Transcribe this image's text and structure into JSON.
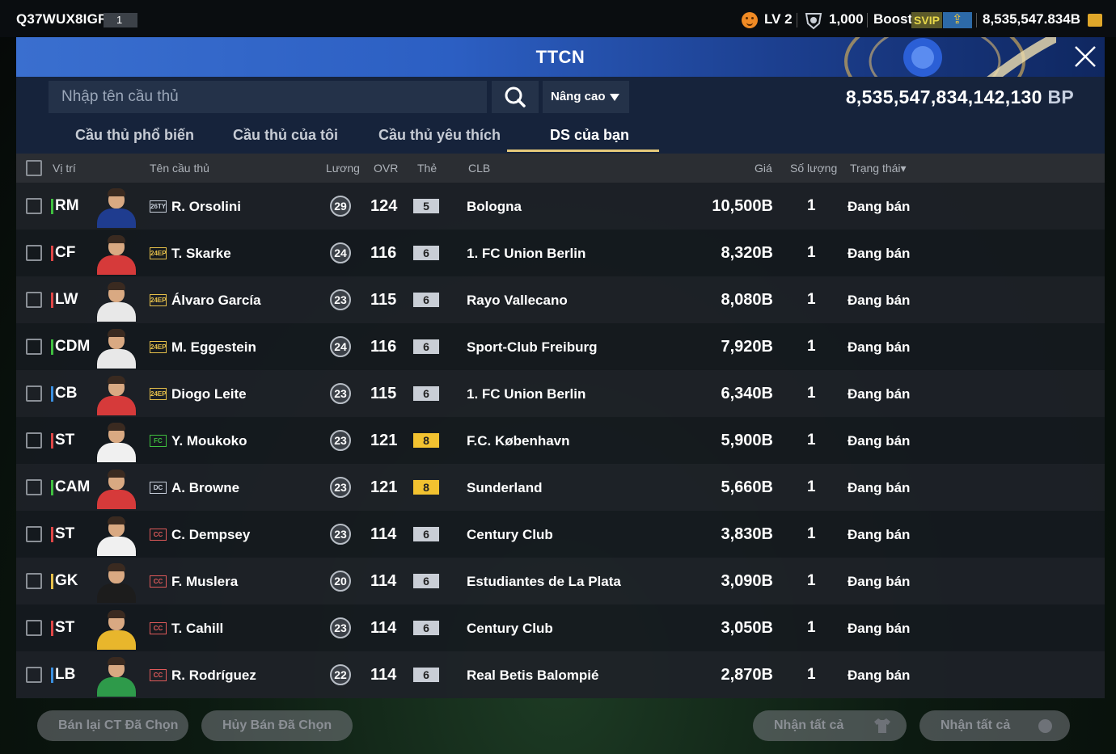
{
  "topbar": {
    "user_id": "Q37WUX8IGR",
    "user_badge": "1",
    "level": "LV 2",
    "points": "1,000",
    "boost_label": "Boost",
    "svip_label": "SVIP",
    "coins": "8,535,547.834B"
  },
  "header": {
    "title": "TTCN"
  },
  "search": {
    "placeholder": "Nhập tên cầu thủ",
    "advanced_label": "Nâng cao",
    "bp_amount": "8,535,547,834,142,130",
    "bp_unit": "BP"
  },
  "tabs": [
    {
      "label": "Cầu thủ phổ biến"
    },
    {
      "label": "Cầu thủ của tôi"
    },
    {
      "label": "Cầu thủ yêu thích"
    },
    {
      "label": "DS của bạn",
      "active": true
    }
  ],
  "columns": {
    "position": "Vị trí",
    "name": "Tên cầu thủ",
    "wage": "Lương",
    "ovr": "OVR",
    "card": "Thẻ",
    "club": "CLB",
    "price": "Giá",
    "qty": "Số lượng",
    "status": "Trạng thái▾"
  },
  "players": [
    {
      "pos": "RM",
      "pos_color": "#3fbf3f",
      "season": "26TY",
      "season_color": "#c9d0dc",
      "name": "R. Orsolini",
      "wage": "29",
      "ovr": "124",
      "card": "5",
      "card_gold": false,
      "club": "Bologna",
      "price": "10,500B",
      "qty": "1",
      "status": "Đang bán",
      "shirt": "#1f3c8f"
    },
    {
      "pos": "CF",
      "pos_color": "#e04646",
      "season": "24EP",
      "season_color": "#e6c04a",
      "name": "T. Skarke",
      "wage": "24",
      "ovr": "116",
      "card": "6",
      "card_gold": false,
      "club": "1. FC Union Berlin",
      "price": "8,320B",
      "qty": "1",
      "status": "Đang bán",
      "shirt": "#d63a3a"
    },
    {
      "pos": "LW",
      "pos_color": "#e04646",
      "season": "24EP",
      "season_color": "#e6c04a",
      "name": "Álvaro García",
      "wage": "23",
      "ovr": "115",
      "card": "6",
      "card_gold": false,
      "club": "Rayo Vallecano",
      "price": "8,080B",
      "qty": "1",
      "status": "Đang bán",
      "shirt": "#e8e8e8"
    },
    {
      "pos": "CDM",
      "pos_color": "#3fbf3f",
      "season": "24EP",
      "season_color": "#e6c04a",
      "name": "M. Eggestein",
      "wage": "24",
      "ovr": "116",
      "card": "6",
      "card_gold": false,
      "club": "Sport-Club Freiburg",
      "price": "7,920B",
      "qty": "1",
      "status": "Đang bán",
      "shirt": "#e8e8e8"
    },
    {
      "pos": "CB",
      "pos_color": "#3a8fe0",
      "season": "24EP",
      "season_color": "#e6c04a",
      "name": "Diogo Leite",
      "wage": "23",
      "ovr": "115",
      "card": "6",
      "card_gold": false,
      "club": "1. FC Union Berlin",
      "price": "6,340B",
      "qty": "1",
      "status": "Đang bán",
      "shirt": "#d63a3a"
    },
    {
      "pos": "ST",
      "pos_color": "#e04646",
      "season": "FC",
      "season_color": "#3fbf3f",
      "name": "Y. Moukoko",
      "wage": "23",
      "ovr": "121",
      "card": "8",
      "card_gold": true,
      "club": "F.C. København",
      "price": "5,900B",
      "qty": "1",
      "status": "Đang bán",
      "shirt": "#f0f0f0"
    },
    {
      "pos": "CAM",
      "pos_color": "#3fbf3f",
      "season": "DC",
      "season_color": "#c9d0dc",
      "name": "A. Browne",
      "wage": "23",
      "ovr": "121",
      "card": "8",
      "card_gold": true,
      "club": "Sunderland",
      "price": "5,660B",
      "qty": "1",
      "status": "Đang bán",
      "shirt": "#d63a3a"
    },
    {
      "pos": "ST",
      "pos_color": "#e04646",
      "season": "CC",
      "season_color": "#e05a5a",
      "name": "C. Dempsey",
      "wage": "23",
      "ovr": "114",
      "card": "6",
      "card_gold": false,
      "club": "Century Club",
      "price": "3,830B",
      "qty": "1",
      "status": "Đang bán",
      "shirt": "#f0f0f0"
    },
    {
      "pos": "GK",
      "pos_color": "#e6c04a",
      "season": "CC",
      "season_color": "#e05a5a",
      "name": "F. Muslera",
      "wage": "20",
      "ovr": "114",
      "card": "6",
      "card_gold": false,
      "club": "Estudiantes de La Plata",
      "price": "3,090B",
      "qty": "1",
      "status": "Đang bán",
      "shirt": "#1c1c1c"
    },
    {
      "pos": "ST",
      "pos_color": "#e04646",
      "season": "CC",
      "season_color": "#e05a5a",
      "name": "T. Cahill",
      "wage": "23",
      "ovr": "114",
      "card": "6",
      "card_gold": false,
      "club": "Century Club",
      "price": "3,050B",
      "qty": "1",
      "status": "Đang bán",
      "shirt": "#e8b62c"
    },
    {
      "pos": "LB",
      "pos_color": "#3a8fe0",
      "season": "CC",
      "season_color": "#e05a5a",
      "name": "R. Rodríguez",
      "wage": "22",
      "ovr": "114",
      "card": "6",
      "card_gold": false,
      "club": "Real Betis Balompié",
      "price": "2,870B",
      "qty": "1",
      "status": "Đang bán",
      "shirt": "#2e9a4a"
    }
  ],
  "bottom": {
    "resell_label": "Bán lại CT Đã Chọn",
    "cancel_label": "Hủy Bán Đã Chọn",
    "claim_all_label_1": "Nhận tất cả",
    "claim_all_label_2": "Nhận tất cả"
  }
}
